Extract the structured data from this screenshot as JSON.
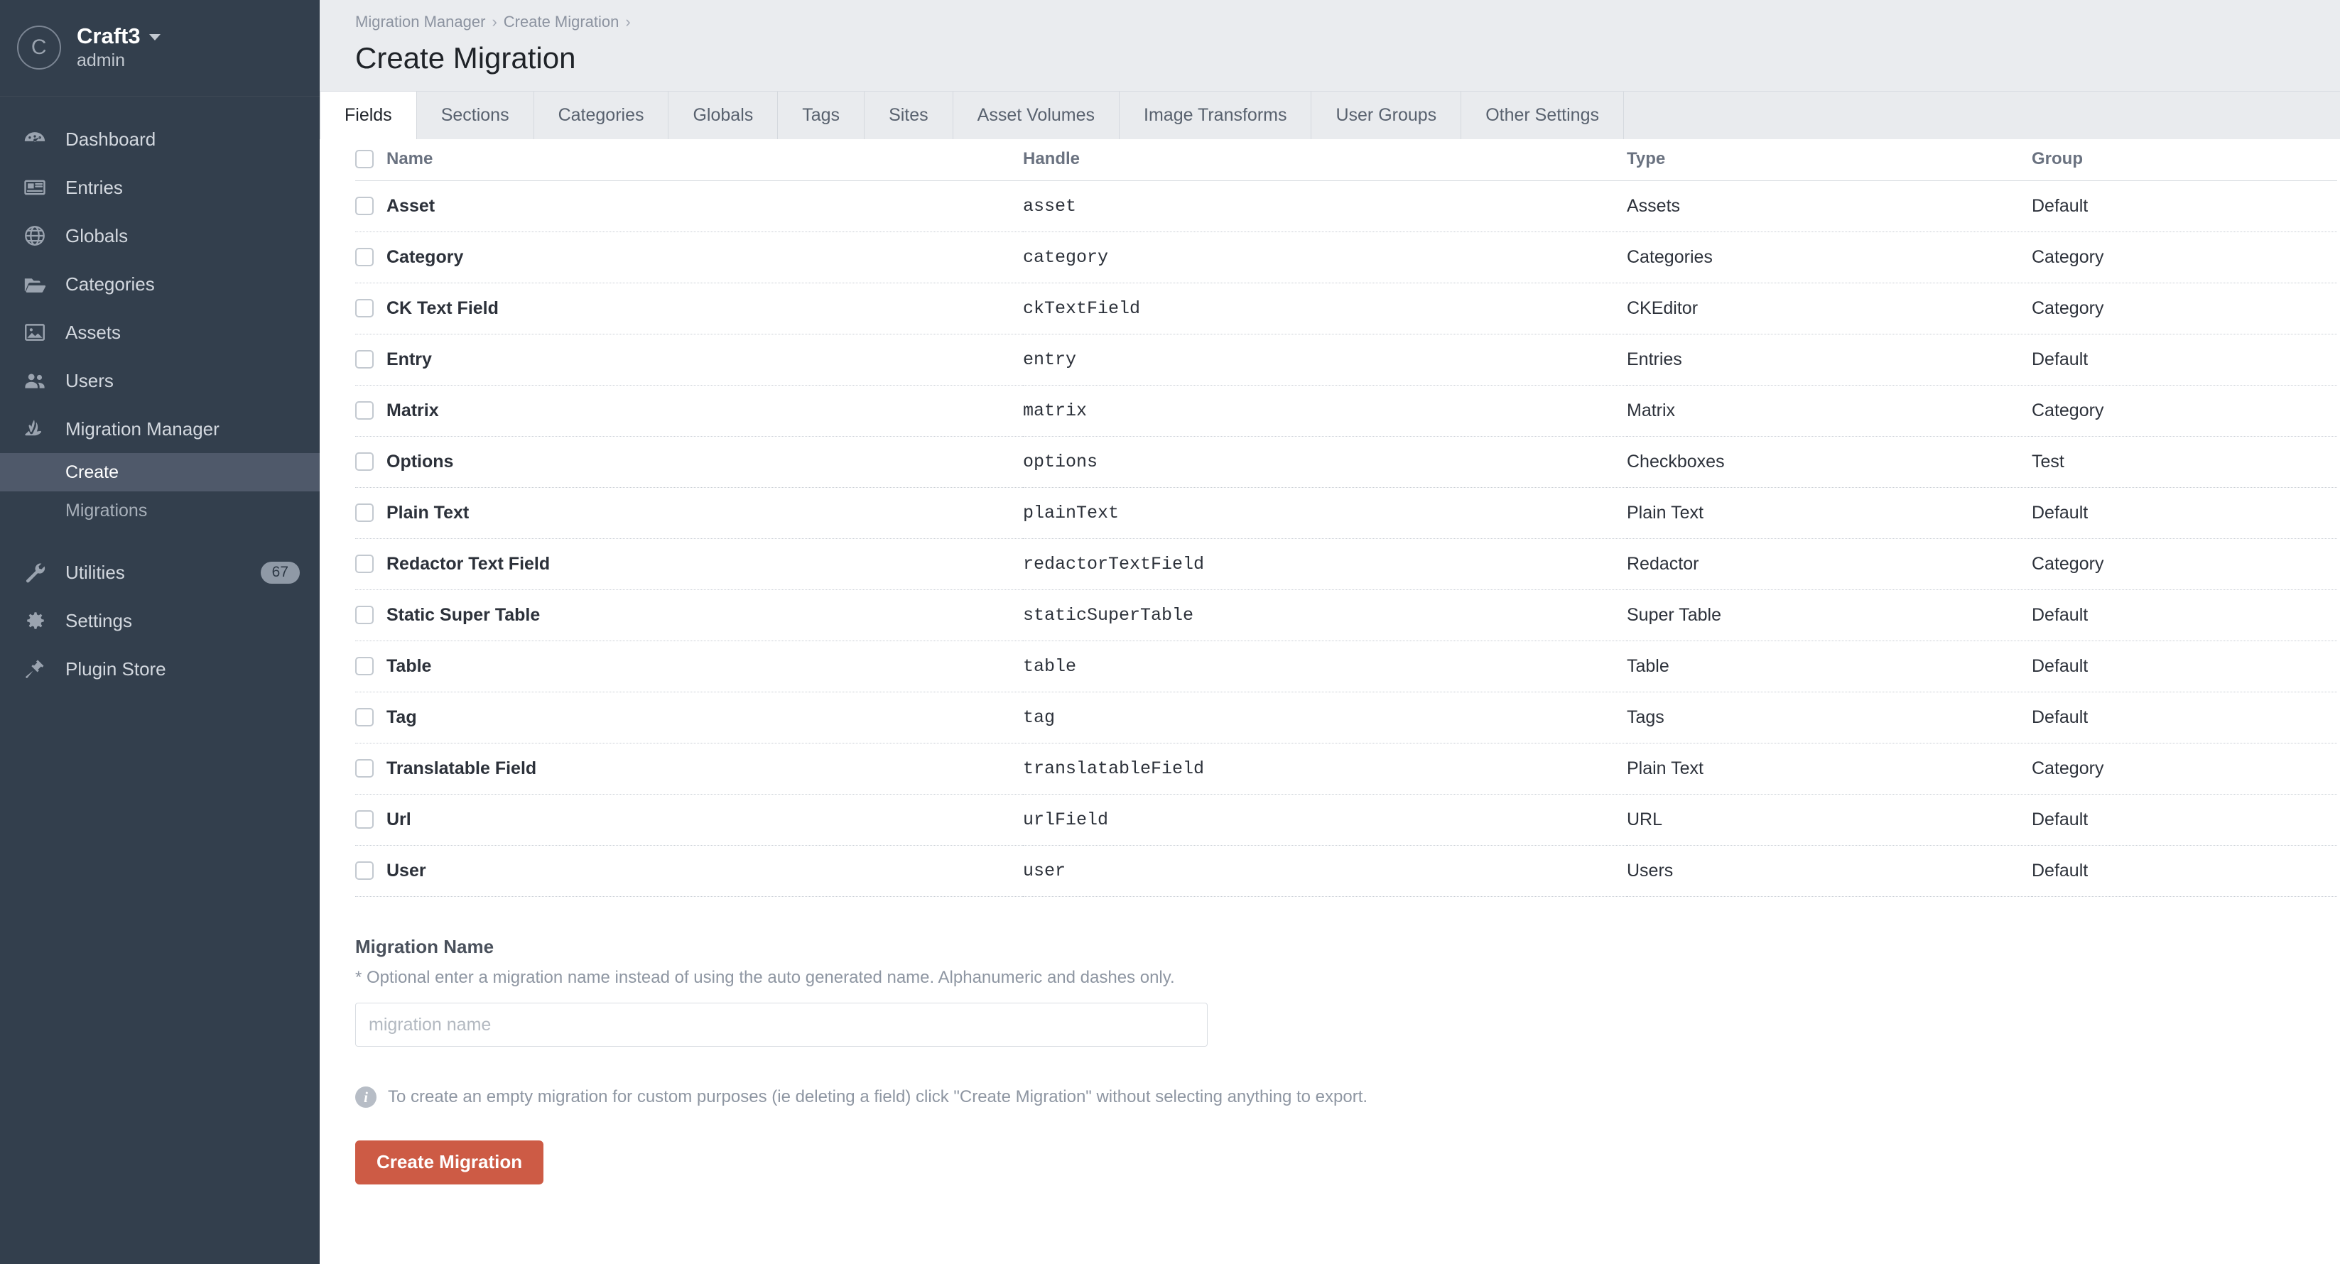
{
  "sidebar": {
    "avatar_letter": "C",
    "site_name": "Craft3",
    "user_name": "admin",
    "items": [
      {
        "label": "Dashboard",
        "icon": "dashboard-icon"
      },
      {
        "label": "Entries",
        "icon": "entries-icon"
      },
      {
        "label": "Globals",
        "icon": "globe-icon"
      },
      {
        "label": "Categories",
        "icon": "folder-icon"
      },
      {
        "label": "Assets",
        "icon": "image-icon"
      },
      {
        "label": "Users",
        "icon": "users-icon"
      },
      {
        "label": "Migration Manager",
        "icon": "bird-icon"
      }
    ],
    "sub_items": [
      {
        "label": "Create",
        "active": true
      },
      {
        "label": "Migrations",
        "active": false
      }
    ],
    "items_lower": [
      {
        "label": "Utilities",
        "icon": "wrench-icon",
        "badge": "67"
      },
      {
        "label": "Settings",
        "icon": "gear-icon",
        "badge": ""
      },
      {
        "label": "Plugin Store",
        "icon": "plug-icon",
        "badge": ""
      }
    ]
  },
  "header": {
    "breadcrumbs": [
      "Migration Manager",
      "Create Migration"
    ],
    "separator": "›",
    "title": "Create Migration"
  },
  "tabs": [
    {
      "label": "Fields",
      "active": true
    },
    {
      "label": "Sections",
      "active": false
    },
    {
      "label": "Categories",
      "active": false
    },
    {
      "label": "Globals",
      "active": false
    },
    {
      "label": "Tags",
      "active": false
    },
    {
      "label": "Sites",
      "active": false
    },
    {
      "label": "Asset Volumes",
      "active": false
    },
    {
      "label": "Image Transforms",
      "active": false
    },
    {
      "label": "User Groups",
      "active": false
    },
    {
      "label": "Other Settings",
      "active": false
    }
  ],
  "table": {
    "columns": [
      "Name",
      "Handle",
      "Type",
      "Group"
    ],
    "rows": [
      {
        "name": "Asset",
        "handle": "asset",
        "type": "Assets",
        "group": "Default"
      },
      {
        "name": "Category",
        "handle": "category",
        "type": "Categories",
        "group": "Category"
      },
      {
        "name": "CK Text Field",
        "handle": "ckTextField",
        "type": "CKEditor",
        "group": "Category"
      },
      {
        "name": "Entry",
        "handle": "entry",
        "type": "Entries",
        "group": "Default"
      },
      {
        "name": "Matrix",
        "handle": "matrix",
        "type": "Matrix",
        "group": "Category"
      },
      {
        "name": "Options",
        "handle": "options",
        "type": "Checkboxes",
        "group": "Test"
      },
      {
        "name": "Plain Text",
        "handle": "plainText",
        "type": "Plain Text",
        "group": "Default"
      },
      {
        "name": "Redactor Text Field",
        "handle": "redactorTextField",
        "type": "Redactor",
        "group": "Category"
      },
      {
        "name": "Static Super Table",
        "handle": "staticSuperTable",
        "type": "Super Table",
        "group": "Default"
      },
      {
        "name": "Table",
        "handle": "table",
        "type": "Table",
        "group": "Default"
      },
      {
        "name": "Tag",
        "handle": "tag",
        "type": "Tags",
        "group": "Default"
      },
      {
        "name": "Translatable Field",
        "handle": "translatableField",
        "type": "Plain Text",
        "group": "Category"
      },
      {
        "name": "Url",
        "handle": "urlField",
        "type": "URL",
        "group": "Default"
      },
      {
        "name": "User",
        "handle": "user",
        "type": "Users",
        "group": "Default"
      }
    ]
  },
  "form": {
    "migration_name_label": "Migration Name",
    "migration_name_hint": "* Optional enter a migration name instead of using the auto generated name. Alphanumeric and dashes only.",
    "migration_name_value": "",
    "migration_name_placeholder": "migration name",
    "note": "To create an empty migration for custom purposes (ie deleting a field) click \"Create Migration\" without selecting anything to export.",
    "submit_label": "Create Migration"
  },
  "colors": {
    "sidebar_bg": "#333f4d",
    "sidebar_active": "#4f596a",
    "header_bg": "#eaecef",
    "tabbar_bg": "#e9ebee",
    "primary_button": "#cd5b45"
  }
}
